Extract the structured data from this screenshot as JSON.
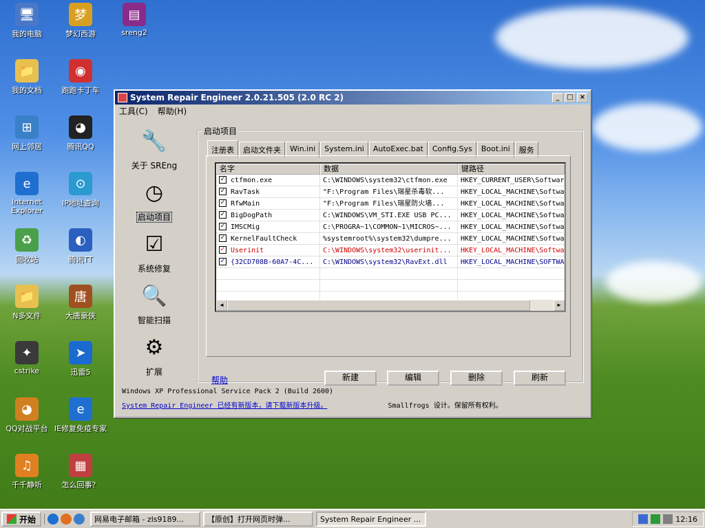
{
  "desktop": {
    "icons": [
      {
        "label": "我的电脑",
        "icon": "computer-icon",
        "color": "#4a78c8",
        "glyph": "🖥"
      },
      {
        "label": "梦幻西游",
        "icon": "game-icon",
        "color": "#d8a020",
        "glyph": "梦"
      },
      {
        "label": "sreng2",
        "icon": "archive-icon",
        "color": "#8a2a8a",
        "glyph": "▤"
      },
      {
        "label": "我的文档",
        "icon": "folder-docs-icon",
        "color": "#e8c050",
        "glyph": "📁"
      },
      {
        "label": "跑跑卡丁车",
        "icon": "kart-icon",
        "color": "#d03030",
        "glyph": "◉"
      },
      {
        "label": "网上邻居",
        "icon": "network-icon",
        "color": "#3a80c8",
        "glyph": "⊞"
      },
      {
        "label": "腾讯QQ",
        "icon": "qq-icon",
        "color": "#222",
        "glyph": "◕"
      },
      {
        "label": "Internet Explorer",
        "icon": "ie-icon",
        "color": "#1f6fd0",
        "glyph": "e"
      },
      {
        "label": "IP地址查询",
        "icon": "ip-icon",
        "color": "#2a9ad0",
        "glyph": "⊙"
      },
      {
        "label": "回收站",
        "icon": "recycle-icon",
        "color": "#4aa04a",
        "glyph": "♻"
      },
      {
        "label": "腾讯TT",
        "icon": "tt-icon",
        "color": "#2a60c0",
        "glyph": "◐"
      },
      {
        "label": "N多文件",
        "icon": "folder-icon",
        "color": "#e8c050",
        "glyph": "📁"
      },
      {
        "label": "大唐豪侠",
        "icon": "datang-icon",
        "color": "#a05020",
        "glyph": "唐"
      },
      {
        "label": "cstrike",
        "icon": "cs-icon",
        "color": "#3a3a3a",
        "glyph": "✦"
      },
      {
        "label": "迅雷5",
        "icon": "xunlei-icon",
        "color": "#1a6ad0",
        "glyph": "➤"
      },
      {
        "label": "QQ对战平台",
        "icon": "qq-battle-icon",
        "color": "#d08020",
        "glyph": "◕"
      },
      {
        "label": "IE修复免疫专家",
        "icon": "ie-repair-icon",
        "color": "#1f6fd0",
        "glyph": "e"
      },
      {
        "label": "千千静听",
        "icon": "music-icon",
        "color": "#e08020",
        "glyph": "♫"
      },
      {
        "label": "怎么回事？",
        "icon": "doc-icon",
        "color": "#c04040",
        "glyph": "▦"
      }
    ]
  },
  "window": {
    "title": "System Repair Engineer 2.0.21.505 (2.0 RC 2)",
    "menu": [
      "工具(C)",
      "帮助(H)"
    ],
    "sidebar": [
      {
        "label": "关于 SREng",
        "icon": "about-tools-icon",
        "glyph": "🔧"
      },
      {
        "label": "启动项目",
        "icon": "clock-icon",
        "glyph": "◷"
      },
      {
        "label": "系统修复",
        "icon": "checklist-icon",
        "glyph": "☑"
      },
      {
        "label": "智能扫描",
        "icon": "magnifier-icon",
        "glyph": "🔍"
      },
      {
        "label": "扩展",
        "icon": "gear-plus-icon",
        "glyph": "⚙"
      }
    ],
    "group_title": "启动项目",
    "tabs": [
      "注册表",
      "启动文件夹",
      "Win.ini",
      "System.ini",
      "AutoExec.bat",
      "Config.Sys",
      "Boot.ini",
      "服务"
    ],
    "columns": [
      "名字",
      "数据",
      "键路径"
    ],
    "rows": [
      {
        "name": "ctfmon.exe",
        "data": "C:\\WINDOWS\\system32\\ctfmon.exe",
        "path": "HKEY_CURRENT_USER\\Softwar",
        "style": ""
      },
      {
        "name": "RavTask",
        "data": "\"F:\\Program Files\\瑞星杀毒软...",
        "path": "HKEY_LOCAL_MACHINE\\Softwa",
        "style": ""
      },
      {
        "name": "RfwMain",
        "data": "\"F:\\Program Files\\瑞星防火墙...",
        "path": "HKEY_LOCAL_MACHINE\\Softwa",
        "style": ""
      },
      {
        "name": "BigDogPath",
        "data": "C:\\WINDOWS\\VM_STI.EXE USB PC...",
        "path": "HKEY_LOCAL_MACHINE\\Softwa",
        "style": ""
      },
      {
        "name": "IMSCMig",
        "data": "C:\\PROGRA~1\\COMMON~1\\MICROS~...",
        "path": "HKEY_LOCAL_MACHINE\\Softwa",
        "style": ""
      },
      {
        "name": "KernelFaultCheck",
        "data": "%systemroot%\\system32\\dumpre...",
        "path": "HKEY_LOCAL_MACHINE\\Softwa",
        "style": ""
      },
      {
        "name": "Userinit",
        "data": "C:\\WINDOWS\\system32\\userinit...",
        "path": "HKEY_LOCAL_MACHINE\\Softwa",
        "style": "red"
      },
      {
        "name": "{32CD708B-60A7-4C...",
        "data": "C:\\WINDOWS\\system32\\RavExt.dll",
        "path": "HKEY_LOCAL_MACHINE\\SOFTWA",
        "style": "blue"
      }
    ],
    "help_link": "帮助",
    "buttons": [
      "新建",
      "编辑",
      "删除",
      "刷新"
    ],
    "status_os": "Windows XP Professional Service Pack 2 (Build 2600)",
    "status_update": "System Repair Engineer 已经有新版本，请下载新版本升级。",
    "status_copyright": "Smallfrogs 设计。保留所有权利。"
  },
  "taskbar": {
    "start": "开始",
    "apps": [
      "网易电子邮箱 - zls9189...",
      "【原创】打开网页时弹...",
      "System Repair Engineer ..."
    ],
    "clock": "12:16"
  }
}
